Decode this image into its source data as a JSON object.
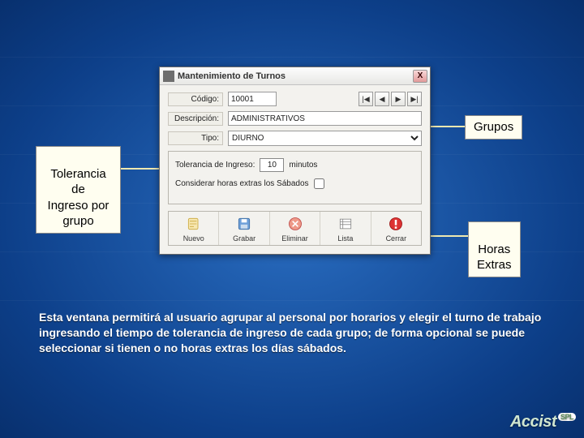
{
  "window": {
    "title": "Mantenimiento de Turnos",
    "close_glyph": "X",
    "fields": {
      "codigo_label": "Código:",
      "codigo_value": "10001",
      "descripcion_label": "Descripción:",
      "descripcion_value": "ADMINISTRATIVOS",
      "tipo_label": "Tipo:",
      "tipo_value": "DIURNO"
    },
    "nav": {
      "first": "|◀",
      "prev": "◀",
      "next": "▶",
      "last": "▶|"
    },
    "group": {
      "tolerancia_label": "Tolerancia de Ingreso:",
      "tolerancia_value": "10",
      "tolerancia_unit": "minutos",
      "sabados_label": "Considerar horas extras los Sábados"
    },
    "toolbar": {
      "nuevo": "Nuevo",
      "grabar": "Grabar",
      "eliminar": "Eliminar",
      "lista": "Lista",
      "cerrar": "Cerrar"
    }
  },
  "callouts": {
    "grupos": "Grupos",
    "tolerancia": "Tolerancia de\nIngreso por\ngrupo",
    "horas": "Horas\nExtras"
  },
  "caption": "Esta ventana permitirá al usuario agrupar al personal por horarios y elegir el turno de trabajo ingresando el tiempo de tolerancia de ingreso de cada grupo; de forma opcional se puede seleccionar si tienen o no horas extras los días sábados.",
  "logo": {
    "text": "Accist",
    "suffix": "SPL"
  },
  "icons": {
    "nuevo": "nuevo-icon",
    "grabar": "grabar-icon",
    "eliminar": "eliminar-icon",
    "lista": "lista-icon",
    "cerrar": "cerrar-icon"
  }
}
